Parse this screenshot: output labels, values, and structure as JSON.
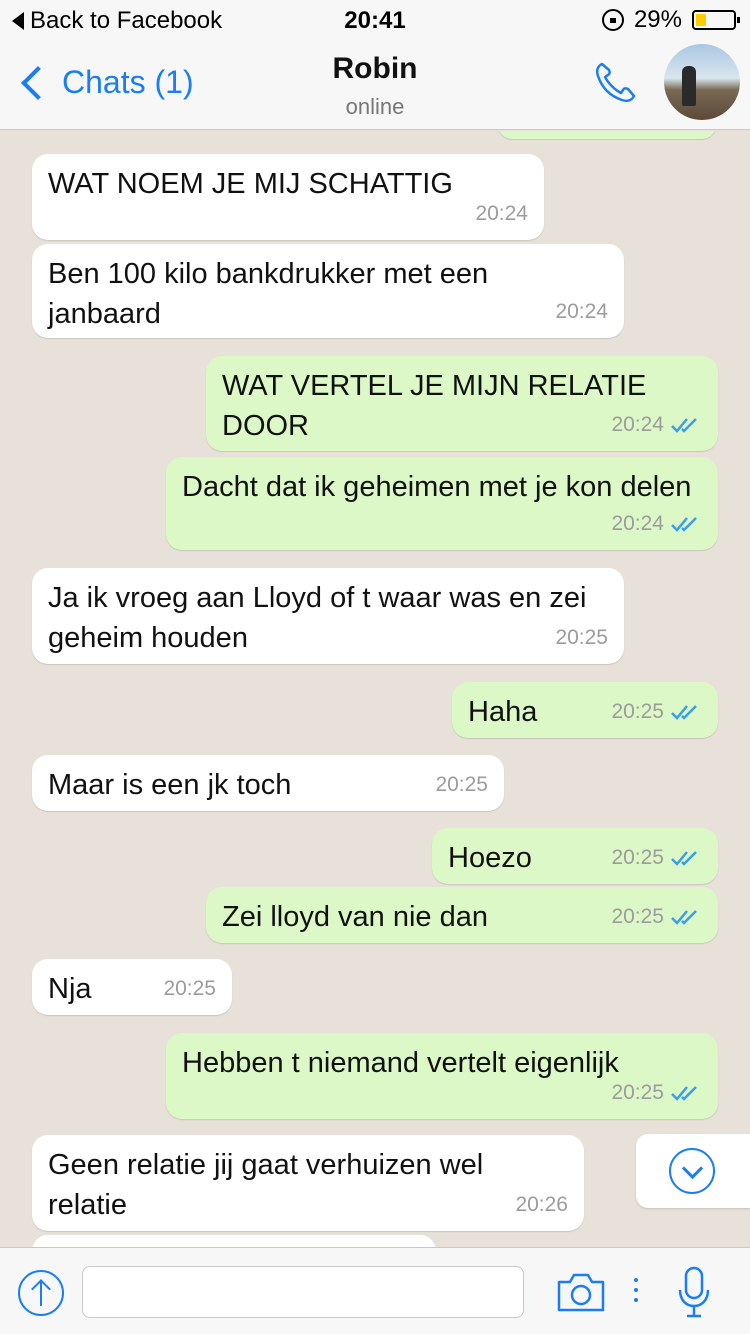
{
  "status_bar": {
    "back_label": "Back to Facebook",
    "time": "20:41",
    "battery": "29%",
    "battery_level": 0.29
  },
  "header": {
    "back_label": "Chats (1)",
    "title": "Robin",
    "subtitle": "online"
  },
  "messages": [
    {
      "dir": "in",
      "text": "WAT NOEM JE MIJ SCHATTIG",
      "time": "20:24"
    },
    {
      "dir": "in",
      "text": "Ben 100 kilo bankdrukker met een janbaard",
      "time": "20:24"
    },
    {
      "dir": "out",
      "text": "WAT VERTEL JE MIJN RELATIE DOOR",
      "time": "20:24",
      "read": true
    },
    {
      "dir": "out",
      "text": "Dacht dat ik geheimen met je kon delen",
      "time": "20:24",
      "read": true
    },
    {
      "dir": "in",
      "text": "Ja ik vroeg aan Lloyd of t waar was en zei geheim houden",
      "time": "20:25"
    },
    {
      "dir": "out",
      "text": "Haha",
      "time": "20:25",
      "read": true
    },
    {
      "dir": "in",
      "text": "Maar is een jk toch",
      "time": "20:25"
    },
    {
      "dir": "out",
      "text": "Hoezo",
      "time": "20:25",
      "read": true
    },
    {
      "dir": "out",
      "text": "Zei lloyd van nie dan",
      "time": "20:25",
      "read": true
    },
    {
      "dir": "in",
      "text": "Nja",
      "time": "20:25"
    },
    {
      "dir": "out",
      "text": "Hebben t niemand vertelt eigenlijk",
      "time": "20:25",
      "read": true
    },
    {
      "dir": "in",
      "text": "Geen relatie jij gaat verhuizen wel relatie",
      "time": "20:26"
    }
  ],
  "input": {
    "placeholder": ""
  },
  "colors": {
    "accent": "#1a7ef2",
    "incoming": "#ffffff",
    "outgoing": "#dcf8c6",
    "background": "#e8e1d9",
    "read_ticks": "#3a9fe8"
  }
}
